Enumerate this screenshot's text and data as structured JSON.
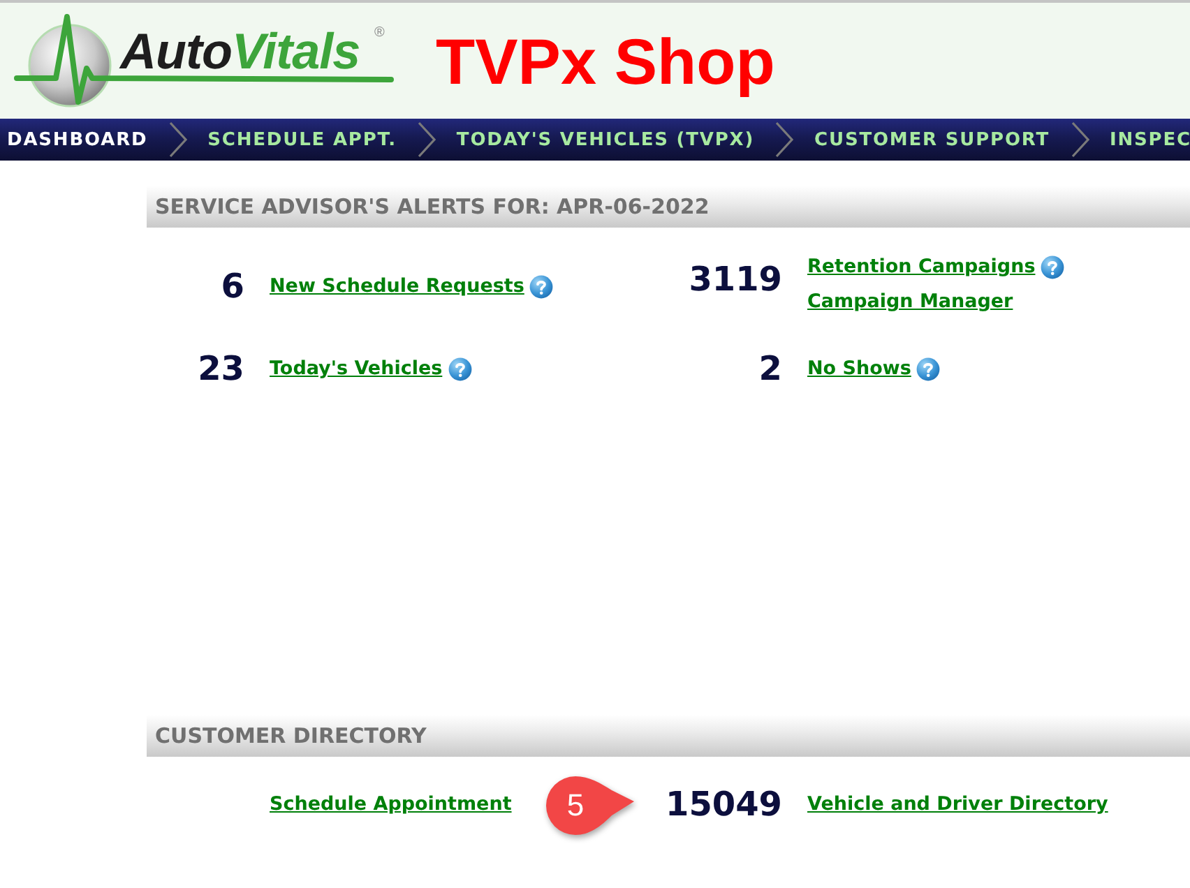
{
  "header": {
    "logo": {
      "word_1": "Auto",
      "word_2": "Vitals",
      "mark": "®"
    },
    "shop_name": "TVPx Shop"
  },
  "nav": {
    "items": [
      {
        "label": "DASHBOARD",
        "selected": true
      },
      {
        "label": "SCHEDULE APPT.",
        "selected": false
      },
      {
        "label": "TODAY'S VEHICLES (TVPX)",
        "selected": false
      },
      {
        "label": "CUSTOMER SUPPORT",
        "selected": false
      },
      {
        "label": "INSPEC",
        "selected": false
      }
    ]
  },
  "alerts_panel": {
    "title": "SERVICE ADVISOR'S ALERTS FOR: APR-06-2022",
    "alerts": [
      {
        "count": "6",
        "links": [
          {
            "label": "New Schedule Requests",
            "help": true
          }
        ]
      },
      {
        "count": "3119",
        "links": [
          {
            "label": "Retention Campaigns",
            "help": true
          },
          {
            "label": "Campaign Manager",
            "help": false
          }
        ]
      },
      {
        "count": "23",
        "links": [
          {
            "label": "Today's Vehicles",
            "help": true
          }
        ]
      },
      {
        "count": "2",
        "links": [
          {
            "label": "No Shows",
            "help": true
          }
        ]
      }
    ]
  },
  "directory_panel": {
    "title": "CUSTOMER DIRECTORY",
    "entries": [
      {
        "links": [
          {
            "label": "Schedule Appointment",
            "help": false
          }
        ]
      },
      {
        "count": "15049",
        "links": [
          {
            "label": "Vehicle and Driver Directory",
            "help": false
          }
        ]
      }
    ],
    "callout": {
      "label": "5"
    }
  }
}
